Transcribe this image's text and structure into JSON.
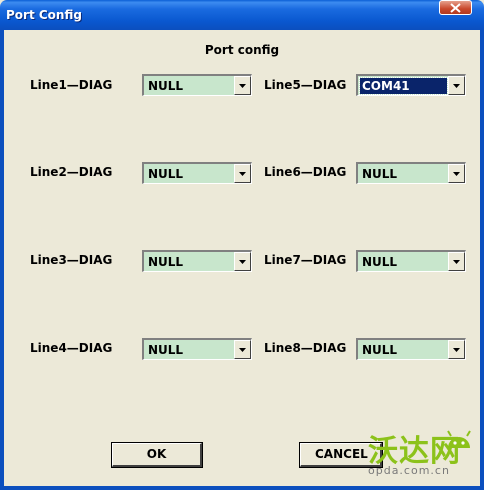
{
  "window": {
    "title": "Port Config"
  },
  "dialog": {
    "heading": "Port config"
  },
  "lines": [
    {
      "label": "Line1—DIAG",
      "value": "NULL",
      "selected": false
    },
    {
      "label": "Line2—DIAG",
      "value": "NULL",
      "selected": false
    },
    {
      "label": "Line3—DIAG",
      "value": "NULL",
      "selected": false
    },
    {
      "label": "Line4—DIAG",
      "value": "NULL",
      "selected": false
    },
    {
      "label": "Line5—DIAG",
      "value": "COM41",
      "selected": true
    },
    {
      "label": "Line6—DIAG",
      "value": "NULL",
      "selected": false
    },
    {
      "label": "Line7—DIAG",
      "value": "NULL",
      "selected": false
    },
    {
      "label": "Line8—DIAG",
      "value": "NULL",
      "selected": false
    }
  ],
  "buttons": {
    "ok": "OK",
    "cancel": "CANCEL"
  },
  "watermark": {
    "text": "沃达网",
    "url": "opda.com.cn"
  },
  "colors": {
    "titlebar": "#0a58d0",
    "combo_bg": "#c8e6cc",
    "selection": "#0a246a",
    "watermark": "#8cc21a"
  }
}
